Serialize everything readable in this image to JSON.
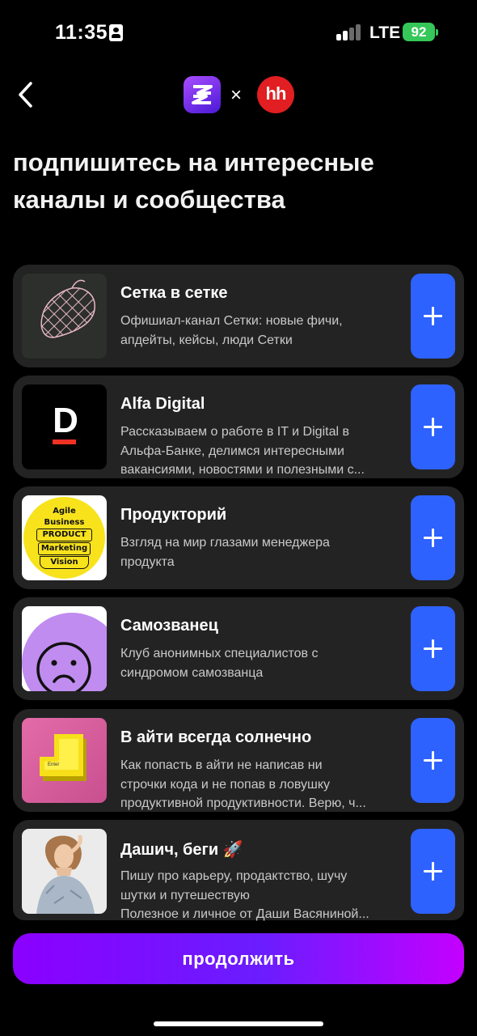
{
  "status_bar": {
    "time": "11:35",
    "network": "LTE",
    "battery": "92"
  },
  "header": {
    "separator": "×",
    "partner_logo_text": "hh",
    "title_lines": [
      "подпишитесь на интересные",
      "каналы и сообщества"
    ]
  },
  "channels": [
    {
      "name": "Сетка в сетке",
      "description": [
        "Офишиал-канал Сетки: новые фичи,",
        "апдейты, кейсы, люди Сетки"
      ],
      "thumb": "net-bag-image"
    },
    {
      "name": "Alfa Digital",
      "description": [
        "Рассказываем о работе в IT и Digital в",
        "Альфа-Банке, делимся интересными",
        "вакансиями, новостями и полезными с..."
      ],
      "thumb": "alfa-logo",
      "thumb_text": "D"
    },
    {
      "name": "Продукторий",
      "description": [
        "Взгляд на мир глазами менеджера",
        "продукта"
      ],
      "thumb": "burger-logo",
      "thumb_words": [
        "Agile",
        "Business",
        "PRODUCT",
        "Marketing",
        "Vision"
      ]
    },
    {
      "name": "Самозванец",
      "description": [
        "Клуб анонимных специалистов с",
        "синдромом самозванца"
      ],
      "thumb": "sad-face-image"
    },
    {
      "name": "В айти всегда солнечно",
      "description": [
        "Как попасть в айти не написав ни",
        "строчки кода и не попав в ловушку",
        "продуктивной продуктивности. Верю, ч..."
      ],
      "thumb": "enter-key-image",
      "thumb_text": "Enter"
    },
    {
      "name": "Дашич, беги 🚀",
      "description": [
        "Пишу про карьеру, продактство, шучу",
        "шутки и путешествую",
        "Полезное и личное от Даши Васяниной..."
      ],
      "thumb": "portrait-photo"
    }
  ],
  "continue_label": "продолжить",
  "colors": {
    "accent_blue": "#2d62ff",
    "card_bg": "#232323",
    "cta_purple": "#8b00ff",
    "hh_red": "#e11e21"
  }
}
